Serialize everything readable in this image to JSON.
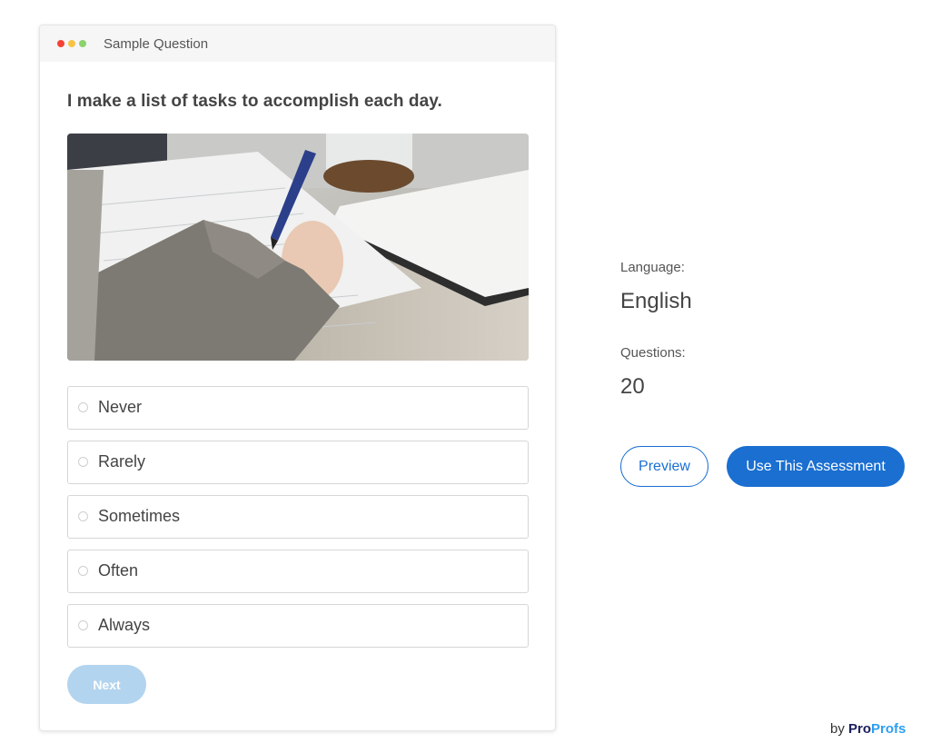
{
  "card": {
    "title": "Sample Question",
    "question": "I make a list of tasks to accomplish each day.",
    "image_description": "photo-hand-writing-notebook",
    "options": [
      {
        "label": "Never"
      },
      {
        "label": "Rarely"
      },
      {
        "label": "Sometimes"
      },
      {
        "label": "Often"
      },
      {
        "label": "Always"
      }
    ],
    "next_label": "Next"
  },
  "details": {
    "language_label": "Language:",
    "language_value": "English",
    "questions_label": "Questions:",
    "questions_value": "20"
  },
  "actions": {
    "preview_label": "Preview",
    "use_label": "Use This Assessment"
  },
  "footer": {
    "by": "by",
    "brand_pro": "Pro",
    "brand_profs": "Profs"
  },
  "colors": {
    "accent": "#1a6fd1",
    "next_disabled": "#b3d4ee",
    "dot_red": "#f44336",
    "dot_yellow": "#f6c343",
    "dot_green": "#8bd36b"
  }
}
